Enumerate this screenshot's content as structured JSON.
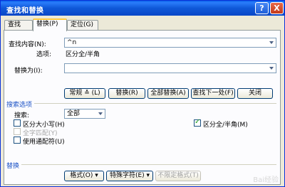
{
  "window": {
    "title": "查找和替换",
    "help_glyph": "?",
    "close_glyph": "X"
  },
  "tabs": [
    {
      "label": "查找(D)"
    },
    {
      "label": "替换(P)"
    },
    {
      "label": "定位(G)"
    }
  ],
  "find": {
    "label": "查找内容(N):",
    "value": "^n",
    "options_label": "选项:",
    "options_value": "区分全/半角"
  },
  "replace": {
    "label": "替换为(I):",
    "value": ""
  },
  "buttons": {
    "less": "常规 ≛ (L)",
    "replace": "替换(R)",
    "replace_all": "全部替换(A)",
    "find_next": "查找下一处(F)",
    "close": "关闭"
  },
  "search_options": {
    "title": "搜索选项",
    "search_label": "搜索:",
    "search_value": "全部",
    "match_case": "区分大小写(H)",
    "whole_word": "全字匹配(Y)",
    "wildcards": "使用通配符(U)",
    "full_half_width": "区分全/半角(M)"
  },
  "replace_section": {
    "title": "替换",
    "format": "格式(O) ▾",
    "special": "特殊字符(E) ▾",
    "no_format": "不限定格式(T)"
  },
  "watermark": "Bai经验"
}
